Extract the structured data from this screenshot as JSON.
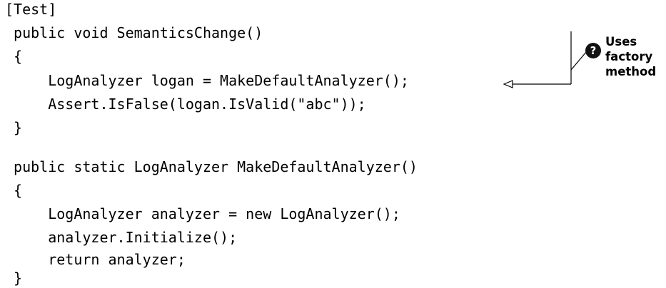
{
  "code": {
    "lines": [
      "[Test]",
      " public void SemanticsChange()",
      " {",
      "     LogAnalyzer logan = MakeDefaultAnalyzer();",
      "     Assert.IsFalse(logan.IsValid(\"abc\"));",
      " }",
      " public static LogAnalyzer MakeDefaultAnalyzer()",
      " {",
      "     LogAnalyzer analyzer = new LogAnalyzer();",
      "     analyzer.Initialize();",
      "     return analyzer;",
      " }"
    ]
  },
  "annotation": {
    "number": "?",
    "text_lines": [
      "Uses",
      "factory",
      "method"
    ]
  }
}
